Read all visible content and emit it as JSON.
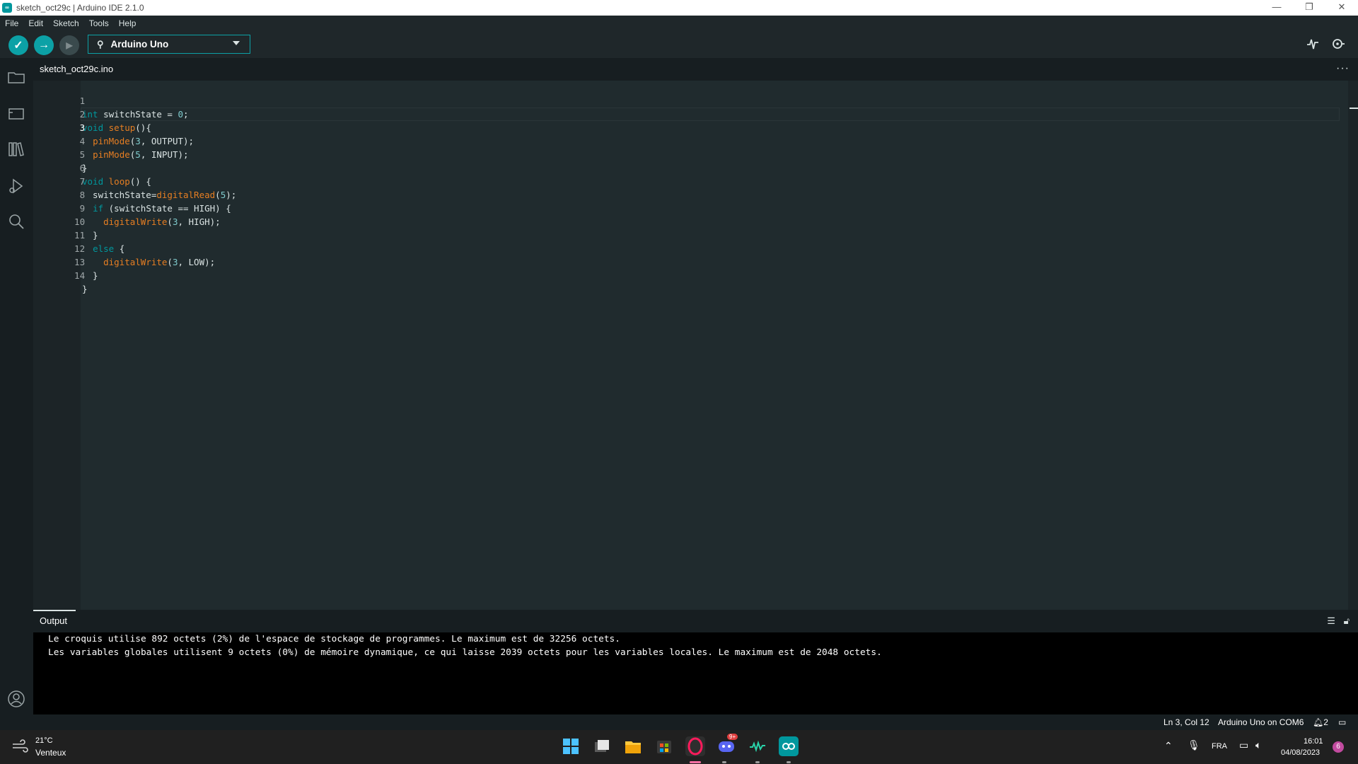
{
  "window": {
    "title": "sketch_oct29c | Arduino IDE 2.1.0",
    "app_icon": "arduino-icon",
    "controls": [
      "—",
      "❐",
      "✕"
    ]
  },
  "menu": [
    "File",
    "Edit",
    "Sketch",
    "Tools",
    "Help"
  ],
  "toolbar": {
    "verify_icon": "✓",
    "upload_icon": "→",
    "debug_icon": "▶",
    "board": "Arduino Uno",
    "serial_plotter_icon": "serial-plotter-icon",
    "serial_monitor_icon": "serial-monitor-icon"
  },
  "sidebar": {
    "items": [
      "sketchbook-icon",
      "boards-manager-icon",
      "library-manager-icon",
      "debug-icon",
      "search-icon"
    ],
    "account": "account-icon"
  },
  "editor": {
    "tab": "sketch_oct29c.ino",
    "tab_menu": "···",
    "lines": [
      {
        "n": "1",
        "code": "int switchState = 0;"
      },
      {
        "n": "2",
        "code": "void setup(){"
      },
      {
        "n": "3",
        "code": "  pinMode(3, OUTPUT);"
      },
      {
        "n": "4",
        "code": "  pinMode(5, INPUT);"
      },
      {
        "n": "5",
        "code": "}"
      },
      {
        "n": "6",
        "code": "void loop() {"
      },
      {
        "n": "7",
        "code": "  switchState=digitalRead(5);"
      },
      {
        "n": "8",
        "code": "  if (switchState == HIGH) {"
      },
      {
        "n": "9",
        "code": "    digitalWrite(3, HIGH);"
      },
      {
        "n": "10",
        "code": "  }"
      },
      {
        "n": "11",
        "code": "  else {"
      },
      {
        "n": "12",
        "code": "    digitalWrite(3, LOW);"
      },
      {
        "n": "13",
        "code": "  }"
      },
      {
        "n": "14",
        "code": "}"
      }
    ]
  },
  "output": {
    "title": "Output",
    "lines": [
      "Le croquis utilise 892 octets (2%) de l'espace de stockage de programmes. Le maximum est de 32256 octets.",
      "Les variables globales utilisent 9 octets (0%) de mémoire dynamique, ce qui laisse 2039 octets pour les variables locales. Le maximum est de 2048 octets."
    ]
  },
  "status": {
    "position": "Ln 3, Col 12",
    "board_port": "Arduino Uno on COM6",
    "notifications": "2"
  },
  "taskbar": {
    "weather_temp": "21°C",
    "weather_desc": "Venteux",
    "language": "FRA",
    "time": "16:01",
    "date": "04/08/2023",
    "notif_count": "6",
    "discord_badge": "9+"
  }
}
